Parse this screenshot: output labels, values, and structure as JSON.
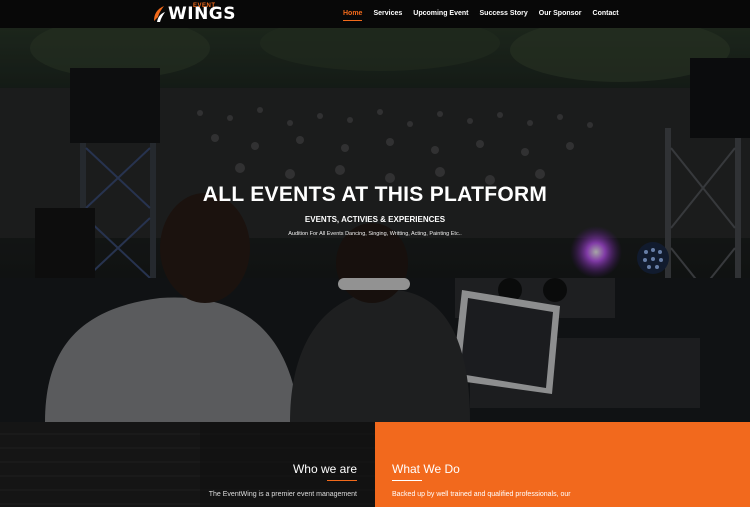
{
  "brand": {
    "logo_small": "EVENT",
    "logo_main": "WINGS"
  },
  "nav": {
    "items": [
      {
        "label": "Home"
      },
      {
        "label": "Services"
      },
      {
        "label": "Upcoming Event"
      },
      {
        "label": "Success Story"
      },
      {
        "label": "Our Sponsor"
      },
      {
        "label": "Contact"
      }
    ]
  },
  "hero": {
    "title": "ALL EVENTS AT THIS PLATFORM",
    "subtitle": "EVENTS, ACTIVIES & EXPERIENCES",
    "description": "Audition For All Events Dancing, Singing, Writting, Acting, Painting Etc.."
  },
  "who": {
    "title": "Who we are",
    "text": "The EventWing is a premier event management"
  },
  "what": {
    "title": "What We Do",
    "text": "Backed up by well trained and qualified professionals, our"
  },
  "colors": {
    "accent": "#f26a1b",
    "nav_bg": "#080808",
    "orange_panel": "#f2691d"
  }
}
